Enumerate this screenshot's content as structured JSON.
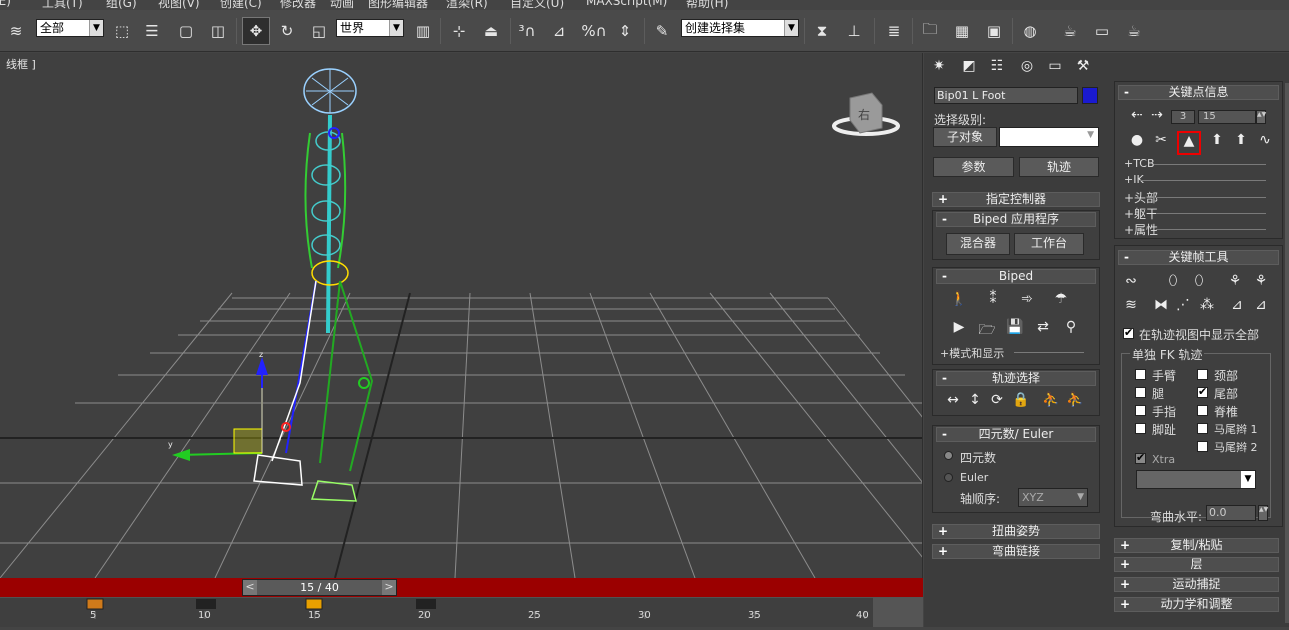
{
  "menu": [
    "(E)",
    "工具(T)",
    "组(G)",
    "视图(V)",
    "创建(C)",
    "修改器",
    "动画",
    "图形编辑器",
    "渲染(R)",
    "自定义(U)",
    "MAXScript(M)",
    "帮助(H)"
  ],
  "toolbar": {
    "filter": "全部",
    "coord": "世界",
    "selset": "创建选择集"
  },
  "viewport": {
    "label": "线框 ]",
    "time": "15 / 40",
    "prev": "<",
    "next": ">",
    "cube_label": "右"
  },
  "timeline": {
    "ticks": [
      "5",
      "10",
      "15",
      "20",
      "25",
      "30",
      "35",
      "40"
    ]
  },
  "cmd": {
    "object_name": "Bip01 L Foot",
    "object_color": "#1a1ad0",
    "sel_level": "选择级别:",
    "sub_object": "子对象",
    "params": "参数",
    "track": "轨迹",
    "assign": "指定控制器",
    "biped_apps": "Biped 应用程序",
    "mixer": "混合器",
    "workbench": "工作台",
    "biped": "Biped",
    "mode_display": "模式和显示",
    "track_sel": "轨迹选择",
    "quat_euler": "四元数/ Euler",
    "quat": "四元数",
    "euler": "Euler",
    "axis_order": "轴顺序:",
    "axis_value": "XYZ",
    "twist": "扭曲姿势",
    "bend": "弯曲链接"
  },
  "key": {
    "title": "关键点信息",
    "frame": "3",
    "value": "15",
    "tcb": "+TCB",
    "ik": "+IK",
    "head": "+头部",
    "trunk": "+躯干",
    "props": "+属性",
    "tools": "关键帧工具",
    "show_all": "在轨迹视图中显示全部",
    "single_fk": "单独 FK 轨迹",
    "arm": "手臂",
    "leg": "腿",
    "finger": "手指",
    "toe": "脚趾",
    "neck": "颈部",
    "tail": "尾部",
    "spine": "脊椎",
    "pony1": "马尾辫 1",
    "pony2": "马尾辫 2",
    "xtra": "Xtra",
    "bend_level": "弯曲水平:",
    "bend_value": "0.0",
    "copy": "复制/粘贴",
    "layer": "层",
    "motion": "运动捕捉",
    "dynamics": "动力学和调整"
  }
}
